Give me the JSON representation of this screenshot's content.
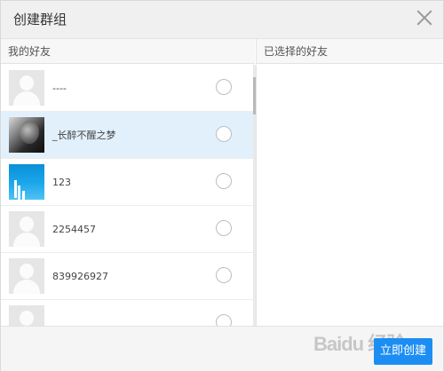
{
  "dialog": {
    "title": "创建群组",
    "create_button": "立即创建"
  },
  "columns": {
    "friends_header": "我的好友",
    "selected_header": "已选择的好友"
  },
  "friends": [
    {
      "name": "----",
      "avatar": "default-avatar-icon",
      "selected": false
    },
    {
      "name": "_长醉不醒之梦",
      "avatar": "photo-dark",
      "selected": true
    },
    {
      "name": "123",
      "avatar": "photo-blue",
      "selected": false
    },
    {
      "name": "2254457",
      "avatar": "default-avatar-icon",
      "selected": false
    },
    {
      "name": "839926927",
      "avatar": "default-avatar-icon",
      "selected": false
    },
    {
      "name": "",
      "avatar": "default-avatar-icon",
      "selected": false
    }
  ],
  "watermark": "Baidu 经验",
  "colors": {
    "accent": "#1c8ef3",
    "row_highlight": "#e2f0fc",
    "header_bg": "#f0f0f0"
  }
}
